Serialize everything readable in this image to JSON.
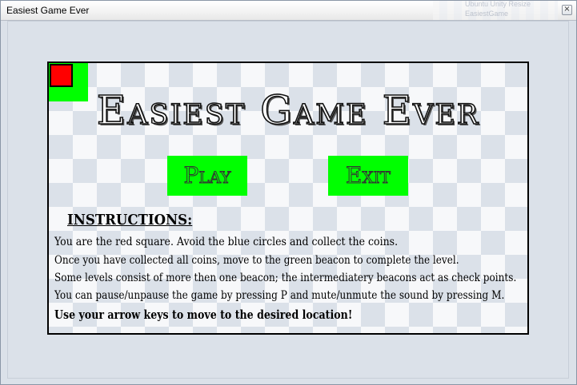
{
  "window": {
    "title": "Easiest Game Ever",
    "close_glyph": "×"
  },
  "background_window": {
    "ghost_line_1": "Ubuntu Unity Resize",
    "ghost_line_2": "EasiestGame"
  },
  "game": {
    "title": "Easiest Game Ever",
    "play_label": "Play",
    "exit_label": "Exit",
    "instructions_heading": "INSTRUCTIONS:",
    "instructions": [
      "You are the red square. Avoid the blue circles and collect the coins.",
      "Once you have collected all coins, move to the green beacon to complete the level.",
      "Some levels consist of more then one beacon; the intermediatery beacons act as check points.",
      "You can pause/unpause the game by pressing P and mute/unmute the sound by pressing M.",
      "Use your arrow keys to move to the desired location!"
    ],
    "colors": {
      "player": "#ff0000",
      "beacon": "#00ff00",
      "button": "#00ff00",
      "checker_dark": "#dbe1e9",
      "checker_light": "#f7f8fa"
    }
  }
}
